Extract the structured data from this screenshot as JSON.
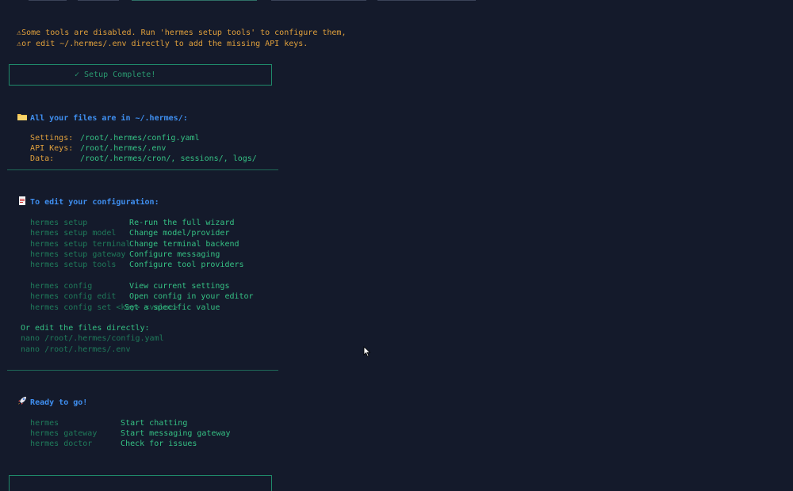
{
  "warnings": [
    "Some tools are disabled. Run 'hermes setup tools' to configure them,",
    "or edit ~/.hermes/.env directly to add the missing API keys."
  ],
  "setup_box": {
    "text": "✓ Setup Complete!"
  },
  "files_section": {
    "title": "All your files are in ~/.hermes/:",
    "items": [
      {
        "label": "Settings:",
        "value": "/root/.hermes/config.yaml"
      },
      {
        "label": "API Keys:",
        "value": "/root/.hermes/.env"
      },
      {
        "label": "Data:",
        "value": "/root/.hermes/cron/, sessions/, logs/"
      }
    ]
  },
  "edit_section": {
    "title": "To edit your configuration:",
    "setup_commands": [
      {
        "cmd": "hermes setup",
        "desc": "Re-run the full wizard"
      },
      {
        "cmd": "hermes setup model",
        "desc": "Change model/provider"
      },
      {
        "cmd": "hermes setup terminal",
        "desc": "Change terminal backend"
      },
      {
        "cmd": "hermes setup gateway",
        "desc": "Configure messaging"
      },
      {
        "cmd": "hermes setup tools",
        "desc": "Configure tool providers"
      }
    ],
    "config_commands": [
      {
        "cmd": "hermes config",
        "desc": "View current settings"
      },
      {
        "cmd": "hermes config edit",
        "desc": "Open config in your editor"
      },
      {
        "cmd": "hermes config set <key> <value>",
        "desc": "Set a specific value"
      }
    ],
    "direct_edit_label": "Or edit the files directly:",
    "direct_edit_lines": [
      "nano /root/.hermes/config.yaml",
      "nano /root/.hermes/.env"
    ]
  },
  "ready_section": {
    "title": "Ready to go!",
    "commands": [
      {
        "cmd": "hermes",
        "desc": "Start chatting"
      },
      {
        "cmd": "hermes gateway",
        "desc": "Start messaging gateway"
      },
      {
        "cmd": "hermes doctor",
        "desc": "Check for issues"
      }
    ]
  },
  "icons": {
    "warning": "warning-icon",
    "folder": "folder-icon",
    "memo": "memo-icon",
    "rocket": "rocket-icon",
    "cursor": "mouse-pointer-icon"
  },
  "colors": {
    "background": "#141a2b",
    "warning": "#e0a03c",
    "header": "#3f8ff0",
    "text": "#2fb37a",
    "dim": "#1f7a5a",
    "border": "#1f8a6a"
  }
}
